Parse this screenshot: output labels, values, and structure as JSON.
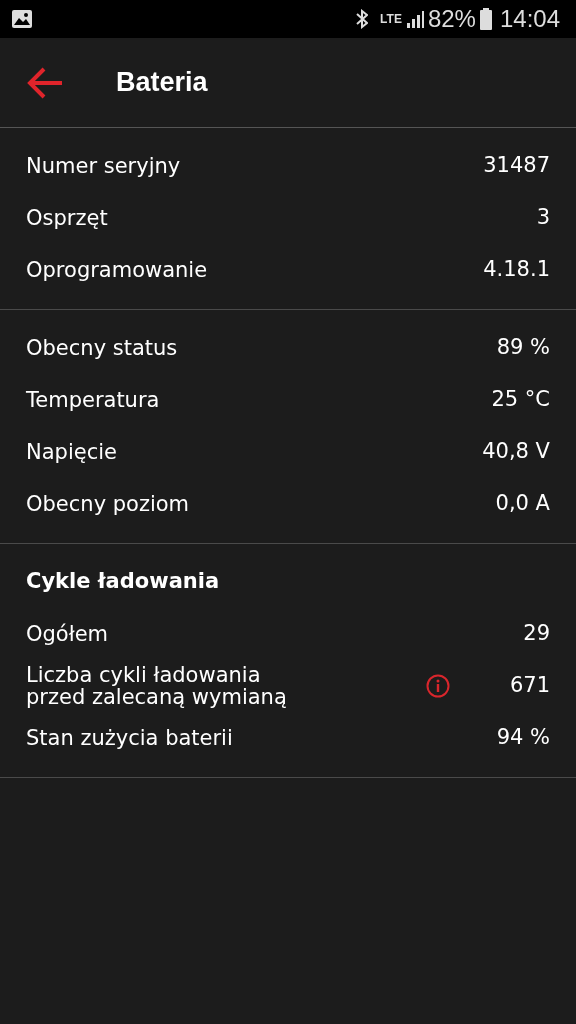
{
  "status_bar": {
    "network": "LTE",
    "battery": "82%",
    "time": "14:04"
  },
  "header": {
    "title": "Bateria"
  },
  "sections": [
    {
      "rows": [
        {
          "label": "Numer seryjny",
          "value": "31487"
        },
        {
          "label": "Osprzęt",
          "value": "3"
        },
        {
          "label": "Oprogramowanie",
          "value": "4.18.1"
        }
      ]
    },
    {
      "rows": [
        {
          "label": "Obecny status",
          "value": "89 %"
        },
        {
          "label": "Temperatura",
          "value": "25 °C"
        },
        {
          "label": "Napięcie",
          "value": "40,8 V"
        },
        {
          "label": "Obecny poziom",
          "value": "0,0 A"
        }
      ]
    },
    {
      "heading": "Cykle ładowania",
      "rows": [
        {
          "label": "Ogółem",
          "value": "29"
        },
        {
          "label": "Liczba cykli ładowania przed zalecaną wymianą",
          "value": "671",
          "info": true
        },
        {
          "label": "Stan zużycia baterii",
          "value": "94 %"
        }
      ]
    }
  ]
}
